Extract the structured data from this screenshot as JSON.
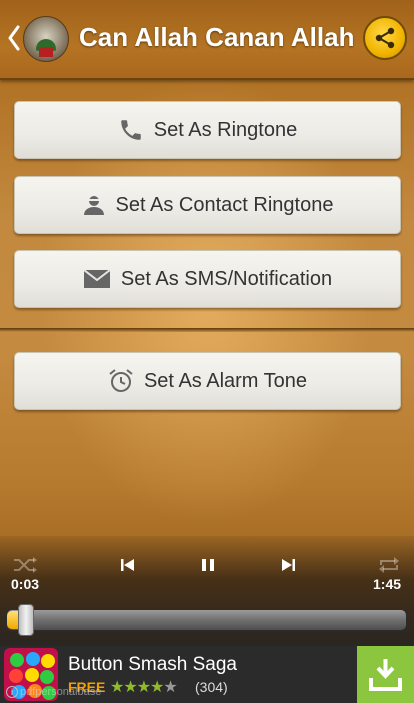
{
  "header": {
    "title": "Can Allah Canan Allah",
    "back_icon": "chevron-left-icon",
    "share_icon": "share-icon",
    "share_color": "#f1b400"
  },
  "actions": [
    {
      "label": "Set As Ringtone",
      "icon": "phone-icon"
    },
    {
      "label": "Set As Contact Ringtone",
      "icon": "contact-icon"
    },
    {
      "label": "Set As SMS/Notification",
      "icon": "envelope-icon"
    },
    {
      "label": "Set As Alarm Tone",
      "icon": "alarm-clock-icon"
    }
  ],
  "player": {
    "elapsed": "0:03",
    "total": "1:45",
    "progress": 0.03,
    "controls": [
      "shuffle-icon",
      "previous-icon",
      "pause-icon",
      "next-icon",
      "repeat-icon"
    ],
    "progress_color": "#f0a800"
  },
  "ad": {
    "title": "Button Smash Saga",
    "price": "FREE",
    "rating": 4,
    "rating_max": 5,
    "review_count": "(304)",
    "source": "pdfpersonalbase",
    "download_color": "#8cc63f"
  }
}
